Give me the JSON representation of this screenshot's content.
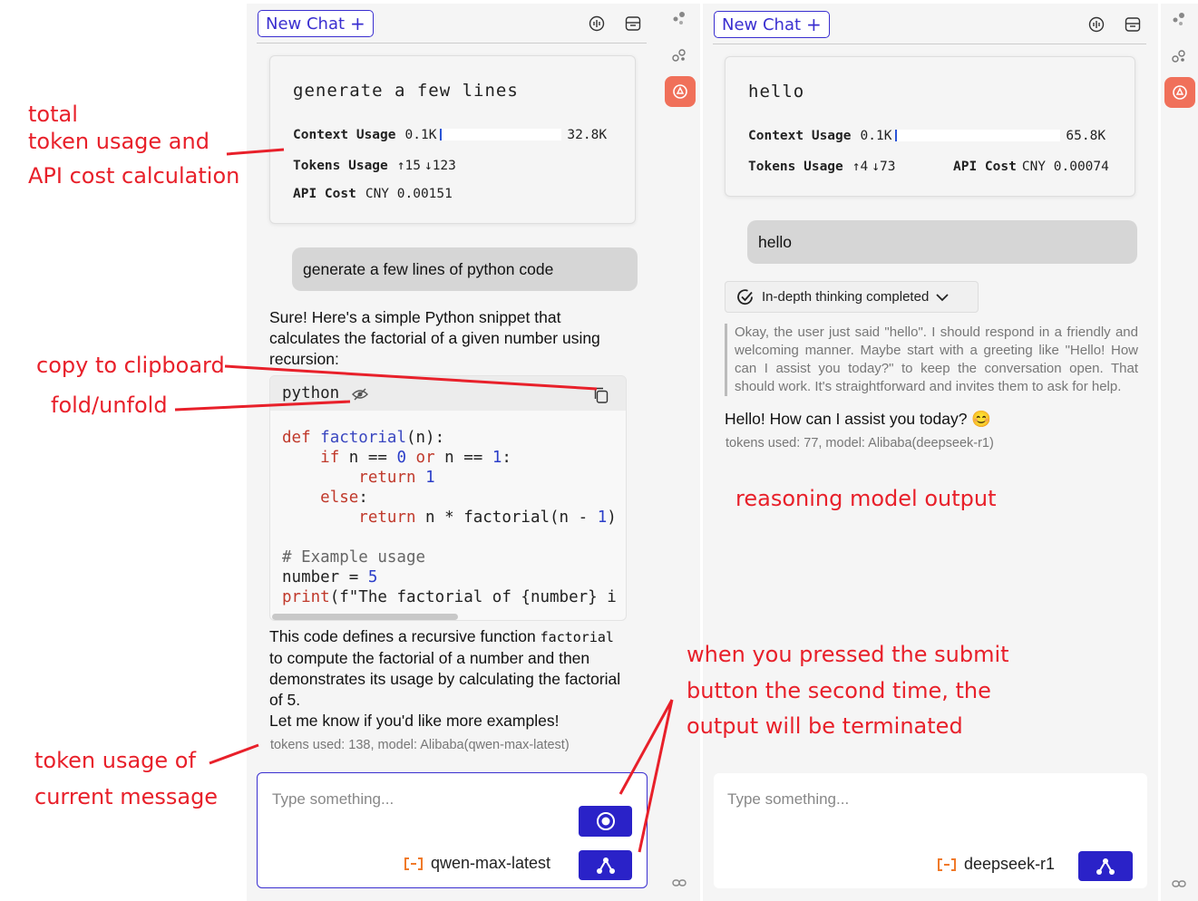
{
  "left_panel": {
    "new_chat_label": "New Chat",
    "stats": {
      "title": "generate a few lines",
      "context_label": "Context Usage",
      "context_used": "0.1K",
      "context_max": "32.8K",
      "tokens_label": "Tokens Usage",
      "tokens_up": "15",
      "tokens_down": "123",
      "cost_label": "API Cost",
      "cost_value": "CNY 0.00151"
    },
    "user_message": "generate a few lines of python code",
    "assistant_intro": "Sure! Here's a simple Python snippet that calculates the factorial of a given number using recursion:",
    "code": {
      "language": "python",
      "lines": [
        "def factorial(n):",
        "    if n == 0 or n == 1:",
        "        return 1",
        "    else:",
        "        return n * factorial(n - 1)",
        "",
        "# Example usage",
        "number = 5",
        "print(f\"The factorial of {number} i"
      ]
    },
    "assistant_outro_1": "This code defines a recursive function",
    "assistant_outro_code": "factorial",
    "assistant_outro_2": "to compute the factorial of a number and then demonstrates its usage by calculating the factorial of 5.",
    "assistant_outro_3": "Let me know if you'd like more examples!",
    "meta": "tokens used: 138, model: Alibaba(qwen-max-latest)",
    "input_placeholder": "Type something...",
    "model_name": "qwen-max-latest"
  },
  "right_panel": {
    "new_chat_label": "New Chat",
    "stats": {
      "title": "hello",
      "context_label": "Context Usage",
      "context_used": "0.1K",
      "context_max": "65.8K",
      "tokens_label": "Tokens Usage",
      "tokens_up": "4",
      "tokens_down": "73",
      "cost_label": "API Cost",
      "cost_value": "CNY 0.00074"
    },
    "user_message": "hello",
    "thinking_label": "In-depth thinking completed",
    "reasoning_text": "Okay, the user just said \"hello\". I should respond in a friendly and welcoming manner. Maybe start with a greeting like \"Hello! How can I assist you today?\" to keep the conversation open. That should work. It's straightforward and invites them to ask for help.",
    "assistant_reply": "Hello! How can I assist you today? 😊",
    "meta": "tokens used: 77, model: Alibaba(deepseek-r1)",
    "input_placeholder": "Type something...",
    "model_name": "deepseek-r1"
  },
  "annotations": {
    "total_1": "total",
    "total_2": "token usage and",
    "total_3": "API cost calculation",
    "copy": "copy to clipboard",
    "fold": "fold/unfold",
    "token_msg_1": "token usage of",
    "token_msg_2": "current message",
    "reasoning": "reasoning model output",
    "submit_1": "when you pressed the submit",
    "submit_2": "button the second time, the",
    "submit_3": "output will be terminated"
  },
  "colors": {
    "accent": "#2a22c8",
    "annotation": "#e8202a",
    "rail_active": "#f0705a",
    "model_icon": "#f07a2a"
  }
}
